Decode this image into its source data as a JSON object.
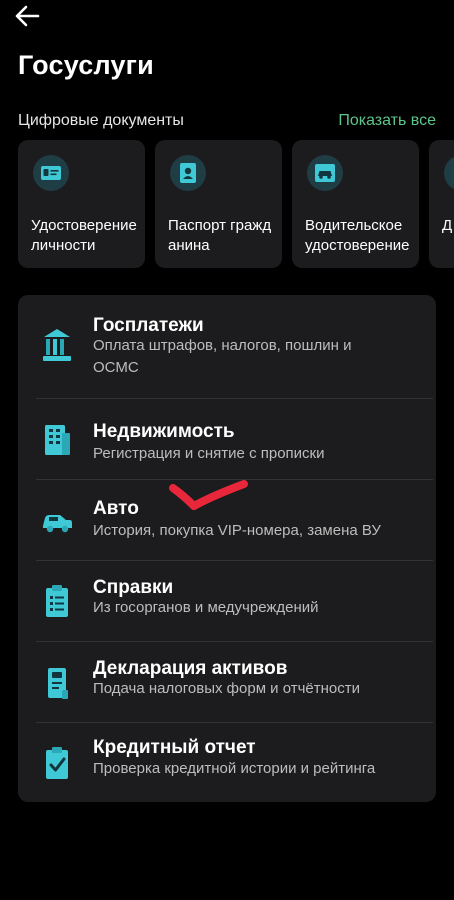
{
  "header": {
    "title": "Госуслуги"
  },
  "digital_documents": {
    "section_label": "Цифровые документы",
    "show_all_label": "Показать все",
    "cards": [
      {
        "label": "Удостоверение личности",
        "icon": "id-card-icon"
      },
      {
        "label": "Паспорт гражданина",
        "icon": "passport-icon"
      },
      {
        "label": "Водительское удостоверение",
        "icon": "car-license-icon"
      },
      {
        "label": "Д",
        "icon": "document-icon"
      }
    ]
  },
  "services": [
    {
      "title": "Госплатежи",
      "subtitle": "Оплата штрафов, налогов, пошлин и ОСМС",
      "icon": "government-building-icon"
    },
    {
      "title": "Недвижимость",
      "subtitle": "Регистрация и снятие с прописки",
      "icon": "apartment-building-icon"
    },
    {
      "title": "Авто",
      "subtitle": "История, покупка VIP-номера, замена ВУ",
      "icon": "car-icon"
    },
    {
      "title": "Справки",
      "subtitle": "Из госорганов и медучреждений",
      "icon": "clipboard-list-icon"
    },
    {
      "title": "Декларация активов",
      "subtitle": "Подача налоговых форм и отчётности",
      "icon": "declaration-form-icon"
    },
    {
      "title": "Кредитный отчет",
      "subtitle": "Проверка кредитной истории и рейтинга",
      "icon": "clipboard-check-icon"
    }
  ],
  "colors": {
    "background": "#000000",
    "card": "#1c1c1e",
    "accent_green": "#5ec48a",
    "icon_teal": "#3fc9d6",
    "annotation_red": "#e8283a"
  }
}
